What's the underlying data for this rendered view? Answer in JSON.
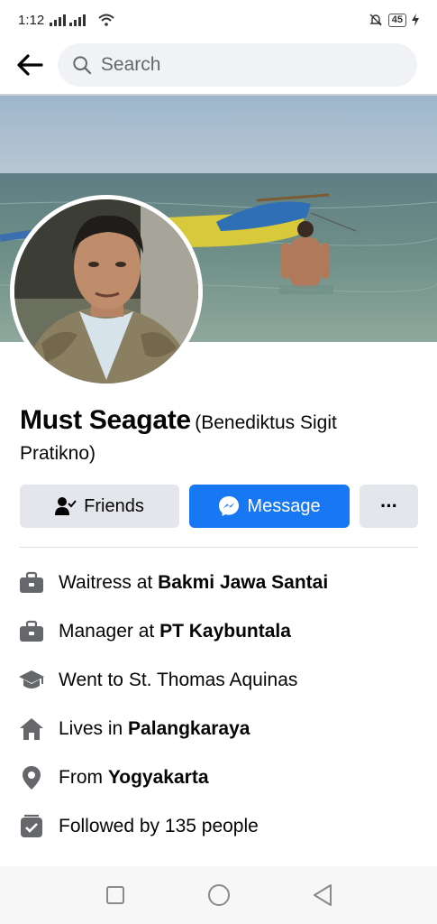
{
  "status_bar": {
    "time": "1:12",
    "battery": "45"
  },
  "search": {
    "placeholder": "Search"
  },
  "profile": {
    "name": "Must Seagate",
    "alternate_name": "(Benediktus Sigit Pratikno)"
  },
  "actions": {
    "friends_label": "Friends",
    "message_label": "Message",
    "more_label": "···"
  },
  "intro": [
    {
      "icon": "briefcase-icon",
      "prefix": "Waitress at ",
      "value": "Bakmi Jawa Santai"
    },
    {
      "icon": "briefcase-icon",
      "prefix": "Manager at ",
      "value": "PT Kaybuntala"
    },
    {
      "icon": "graduation-cap-icon",
      "prefix": "Went to St. Thomas Aquinas",
      "value": ""
    },
    {
      "icon": "home-icon",
      "prefix": "Lives in ",
      "value": "Palangkaraya"
    },
    {
      "icon": "location-pin-icon",
      "prefix": "From ",
      "value": "Yogyakarta"
    },
    {
      "icon": "followers-icon",
      "prefix": "Followed by 135 people",
      "value": ""
    }
  ],
  "colors": {
    "brand_blue": "#1877f2",
    "button_grey": "#e4e6eb",
    "icon_grey": "#65676b"
  }
}
